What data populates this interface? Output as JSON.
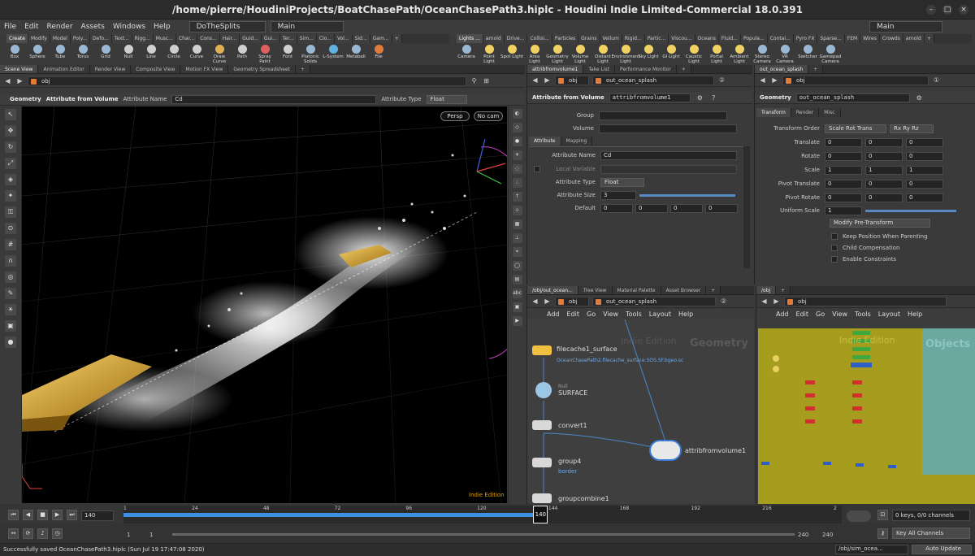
{
  "window": {
    "title": "/home/pierre/HoudiniProjects/BoatChasePath/OceanChasePath3.hiplc - Houdini Indie Limited-Commercial 18.0.391"
  },
  "menubar": {
    "items": [
      "File",
      "Edit",
      "Render",
      "Assets",
      "Windows",
      "Help"
    ],
    "desktop": "DoTheSplits",
    "layout": "Main",
    "right_label": "Main"
  },
  "shelf_left": {
    "tabs": [
      "Create",
      "Modify",
      "Model",
      "Poly...",
      "Defo...",
      "Text...",
      "Rigg...",
      "Musc...",
      "Char...",
      "Cons...",
      "Hair...",
      "Guid...",
      "Gui...",
      "Ter...",
      "Sim...",
      "Clo...",
      "Vol...",
      "Sid...",
      "Gam..."
    ],
    "tools": [
      {
        "label": "Box",
        "color": "#9ab7d3"
      },
      {
        "label": "Sphere",
        "color": "#9ab7d3"
      },
      {
        "label": "Tube",
        "color": "#9ab7d3"
      },
      {
        "label": "Torus",
        "color": "#9ab7d3"
      },
      {
        "label": "Grid",
        "color": "#9ab7d3"
      },
      {
        "label": "Null",
        "color": "#cfcfcf"
      },
      {
        "label": "Line",
        "color": "#cfcfcf"
      },
      {
        "label": "Circle",
        "color": "#cfcfcf"
      },
      {
        "label": "Curve",
        "color": "#cfcfcf"
      },
      {
        "label": "Draw Curve",
        "color": "#e0b050"
      },
      {
        "label": "Path",
        "color": "#cfcfcf"
      },
      {
        "label": "Spray Paint",
        "color": "#e06060"
      },
      {
        "label": "Font",
        "color": "#cfcfcf"
      },
      {
        "label": "Platonic Solids",
        "color": "#9ab7d3"
      },
      {
        "label": "L-System",
        "color": "#60b0e0"
      },
      {
        "label": "Metaball",
        "color": "#9ab7d3"
      },
      {
        "label": "File",
        "color": "#e07b39"
      }
    ]
  },
  "shelf_right": {
    "tabs": [
      "Lights ...",
      "arnold",
      "Drive...",
      "Collisi...",
      "Particles",
      "Grains",
      "Vellum",
      "Rigid...",
      "Partic...",
      "Viscou...",
      "Oceans",
      "Fluid...",
      "Popula...",
      "Contai...",
      "Pyro FX",
      "Sparse...",
      "FEM",
      "Wires",
      "Crowds",
      "arnold"
    ],
    "tools": [
      {
        "label": "Camera",
        "color": "#9ab7d3"
      },
      {
        "label": "Point Light",
        "color": "#f0d060"
      },
      {
        "label": "Spot Light",
        "color": "#f0d060"
      },
      {
        "label": "Area Light",
        "color": "#f0d060"
      },
      {
        "label": "Geometry Light",
        "color": "#f0d060"
      },
      {
        "label": "Volume Light",
        "color": "#f0d060"
      },
      {
        "label": "Distant Light",
        "color": "#f0d060"
      },
      {
        "label": "Environment Light",
        "color": "#f0d060"
      },
      {
        "label": "Sky Light",
        "color": "#f0d060"
      },
      {
        "label": "GI Light",
        "color": "#f0d060"
      },
      {
        "label": "Caustic Light",
        "color": "#f0d060"
      },
      {
        "label": "Portal Light",
        "color": "#f0d060"
      },
      {
        "label": "Ambient Light",
        "color": "#f0d060"
      },
      {
        "label": "Stereo Camera",
        "color": "#9ab7d3"
      },
      {
        "label": "VR Camera",
        "color": "#9ab7d3"
      },
      {
        "label": "Switcher",
        "color": "#9ab7d3"
      },
      {
        "label": "Gamepad Camera",
        "color": "#9ab7d3"
      }
    ]
  },
  "scene_view": {
    "tabs": [
      "Scene View",
      "Animation Editor",
      "Render View",
      "Composite View",
      "Motion FX View",
      "Geometry Spreadsheet"
    ],
    "path": "obj",
    "context": "Geometry",
    "state_label": "Attribute from Volume",
    "attr_name_label": "Attribute Name",
    "attr_name_value": "Cd",
    "attr_type_label": "Attribute Type",
    "attr_type_value": "Float",
    "persp": "Persp",
    "cam": "No cam",
    "watermark": "Indie Edition"
  },
  "parm_left": {
    "tabs": [
      "attribfromvolume1",
      "Take List",
      "Performance Monitor"
    ],
    "path": "obj",
    "node_path": "out_ocean_splash",
    "node_type": "Attribute from Volume",
    "node_name": "attribfromvolume1",
    "group_label": "Group",
    "volume_label": "Volume",
    "subtabs": [
      "Attribute",
      "Mapping"
    ],
    "rows": [
      {
        "label": "Attribute Name",
        "value": "Cd"
      },
      {
        "label": "Local Variable",
        "value": ""
      },
      {
        "label": "Attribute Type",
        "value": "Float"
      },
      {
        "label": "Attribute Size",
        "value": "3"
      },
      {
        "label": "Default",
        "values": [
          "0",
          "0",
          "0",
          "0"
        ]
      }
    ]
  },
  "parm_right": {
    "tabs": [
      "out_ocean_splash"
    ],
    "path": "obj",
    "node_type": "Geometry",
    "node_name": "out_ocean_splash",
    "subtabs": [
      "Transform",
      "Render",
      "Misc"
    ],
    "transform_order_label": "Transform Order",
    "transform_order": "Scale Rot Trans",
    "rot_order": "Rx Ry Rz",
    "rows": [
      {
        "label": "Translate",
        "values": [
          "0",
          "0",
          "0"
        ]
      },
      {
        "label": "Rotate",
        "values": [
          "0",
          "0",
          "0"
        ]
      },
      {
        "label": "Scale",
        "values": [
          "1",
          "1",
          "1"
        ]
      },
      {
        "label": "Pivot Translate",
        "values": [
          "0",
          "0",
          "0"
        ]
      },
      {
        "label": "Pivot Rotate",
        "values": [
          "0",
          "0",
          "0"
        ]
      }
    ],
    "uniform_scale_label": "Uniform Scale",
    "uniform_scale": "1",
    "modify_btn": "Modify Pre-Transform",
    "checks": [
      "Keep Position When Parenting",
      "Child Compensation",
      "Enable Constraints"
    ]
  },
  "network_left": {
    "tabs": [
      "/obj/out_ocean...",
      "Tree View",
      "Material Palette",
      "Asset Browser"
    ],
    "path": "obj",
    "node_path": "out_ocean_splash",
    "menu": [
      "Add",
      "Edit",
      "Go",
      "View",
      "Tools",
      "Layout",
      "Help"
    ],
    "watermark": "Indie Edition",
    "context": "Geometry",
    "nodes": [
      {
        "name": "filecache1_surface",
        "sub": "OceanChasePath2.filecache_surface.SOS.SF.bgeo.sc"
      },
      {
        "name": "SURFACE",
        "type": "Null"
      },
      {
        "name": "convert1"
      },
      {
        "name": "group4",
        "sub": "border"
      },
      {
        "name": "groupcombine1"
      },
      {
        "name": "attribfromvolume1"
      }
    ]
  },
  "network_right": {
    "tabs": [
      "/obj"
    ],
    "path": "obj",
    "menu": [
      "Add",
      "Edit",
      "Go",
      "View",
      "Tools",
      "Layout",
      "Help"
    ],
    "watermark": "Indie Edition",
    "context": "Objects"
  },
  "timeline": {
    "frame": "140",
    "ticks": [
      "1",
      "24",
      "48",
      "72",
      "96",
      "120",
      "144",
      "168",
      "192",
      "216",
      "2"
    ],
    "keys": "0 keys, 0/0 channels",
    "key_all": "Key All Channels",
    "start": "1",
    "start2": "1",
    "end": "240",
    "end2": "240"
  },
  "status": {
    "message": "Successfully saved OceanChasePath3.hiplc (Sun Jul 19 17:47:08 2020)",
    "path": "/obj/sim_ocea...",
    "update": "Auto Update"
  }
}
